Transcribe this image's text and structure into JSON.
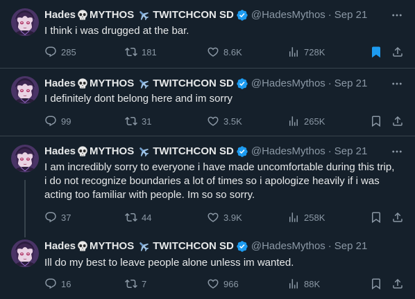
{
  "user": {
    "name_prefix": "Hades",
    "name_mid": "MYTHOS",
    "name_suffix": "TWITCHCON SD",
    "handle": "@HadesMythos",
    "dot": "·"
  },
  "colors": {
    "background": "#15202b",
    "text": "#e7e9ea",
    "muted": "#8b98a5",
    "verified": "#1d9bf0",
    "bookmarked": "#1d9bf0",
    "divider": "#38444d"
  },
  "tweets": [
    {
      "date": "Sep 21",
      "text": "I think i was drugged at the bar.",
      "replies": "285",
      "reposts": "181",
      "likes": "8.6K",
      "views": "728K",
      "bookmarked": true
    },
    {
      "date": "Sep 21",
      "text": "I definitely dont belong here and im sorry",
      "replies": "99",
      "reposts": "31",
      "likes": "3.5K",
      "views": "265K",
      "bookmarked": false
    },
    {
      "date": "Sep 21",
      "text": "I am incredibly sorry to everyone i have made uncomfortable during this trip, i do not recognize boundaries a lot of times so i apologize heavily if i was acting too familiar with people. Im so so sorry.",
      "replies": "37",
      "reposts": "44",
      "likes": "3.9K",
      "views": "258K",
      "bookmarked": false
    },
    {
      "date": "Sep 21",
      "text": "Ill do my best to leave people alone unless im wanted.",
      "replies": "16",
      "reposts": "7",
      "likes": "966",
      "views": "88K",
      "bookmarked": false
    }
  ]
}
